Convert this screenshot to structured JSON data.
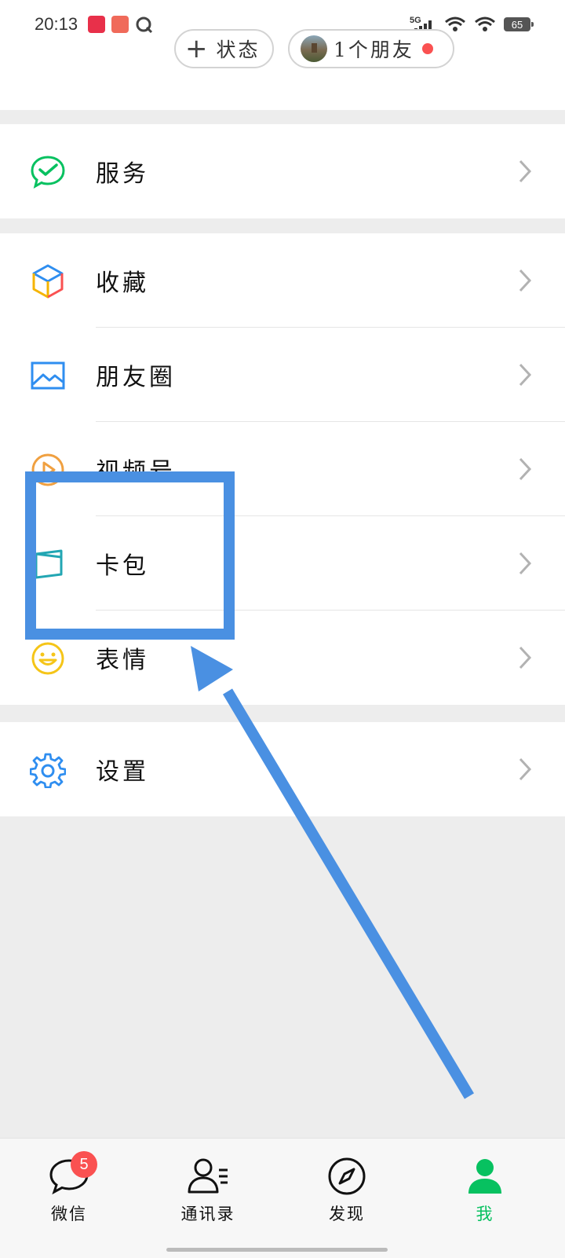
{
  "status_bar": {
    "time": "20:13",
    "network": "5G",
    "battery": "65"
  },
  "header": {
    "status_button_label": "状态",
    "friends_button_label": "1个朋友"
  },
  "menu": {
    "services": "服务",
    "favorites": "收藏",
    "moments": "朋友圈",
    "channels": "视频号",
    "cards": "卡包",
    "stickers": "表情",
    "settings": "设置"
  },
  "tabbar": {
    "chats": "微信",
    "chats_badge": "5",
    "contacts": "通讯录",
    "discover": "发现",
    "me": "我"
  },
  "colors": {
    "accent": "#07c160",
    "badge": "#fa5151",
    "annotation": "#4a90e2"
  }
}
